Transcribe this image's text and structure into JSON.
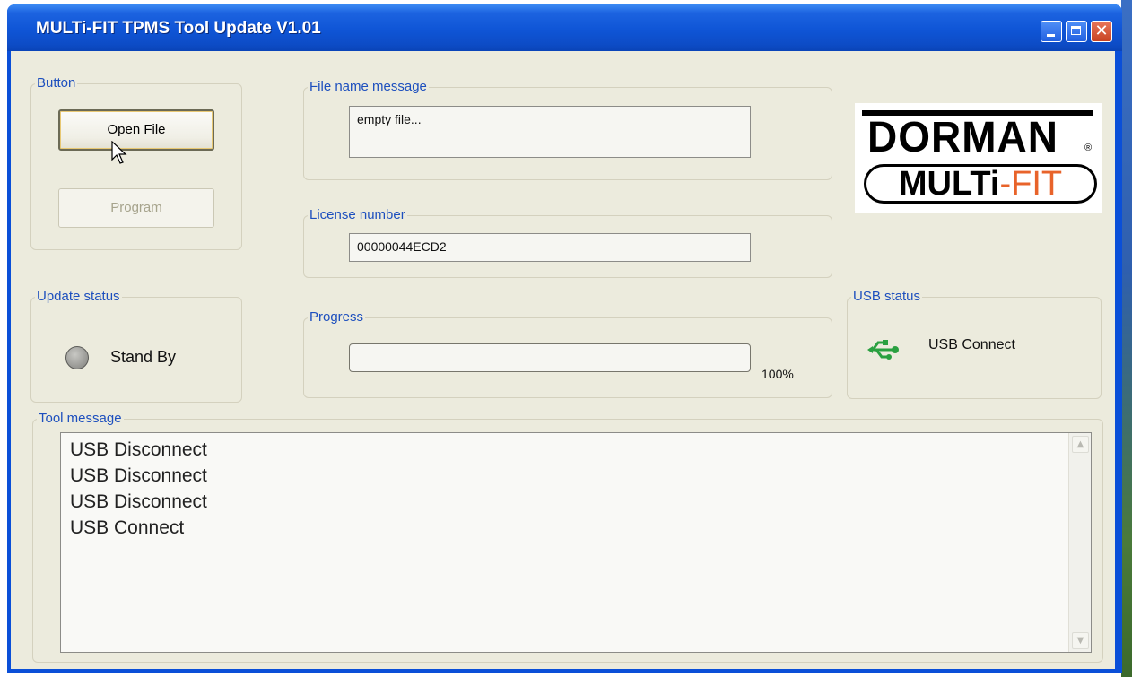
{
  "window": {
    "title": "MULTi-FIT TPMS Tool Update V1.01",
    "close_glyph": "✕"
  },
  "button_group": {
    "label": "Button",
    "open_file_label": "Open File",
    "program_label": "Program"
  },
  "file_name": {
    "label": "File name message",
    "value": "empty file..."
  },
  "license": {
    "label": "License number",
    "value": "00000044ECD2"
  },
  "update_status": {
    "label": "Update status",
    "status_text": "Stand By",
    "led_color": "#9a9a96"
  },
  "progress": {
    "label": "Progress",
    "percent_text": "100%",
    "fill_fraction": 0
  },
  "usb_status": {
    "label": "USB status",
    "status_text": "USB Connect",
    "icon": "usb-icon",
    "icon_color": "#2aa040"
  },
  "tool_message": {
    "label": "Tool message",
    "lines": [
      "USB Disconnect",
      "USB Disconnect",
      "USB Disconnect",
      "USB Connect"
    ]
  },
  "logo": {
    "brand_top": "DORMAN",
    "brand_bottom_left": "MULTi",
    "brand_bottom_right": "-FIT",
    "registered": "®",
    "accent": "#e8632a"
  },
  "scroll_glyphs": {
    "up": "▲",
    "down": "▼"
  },
  "colors": {
    "group_label": "#1d4fbe",
    "titlebar": "#0f55d6",
    "client_bg": "#ecebdd"
  }
}
